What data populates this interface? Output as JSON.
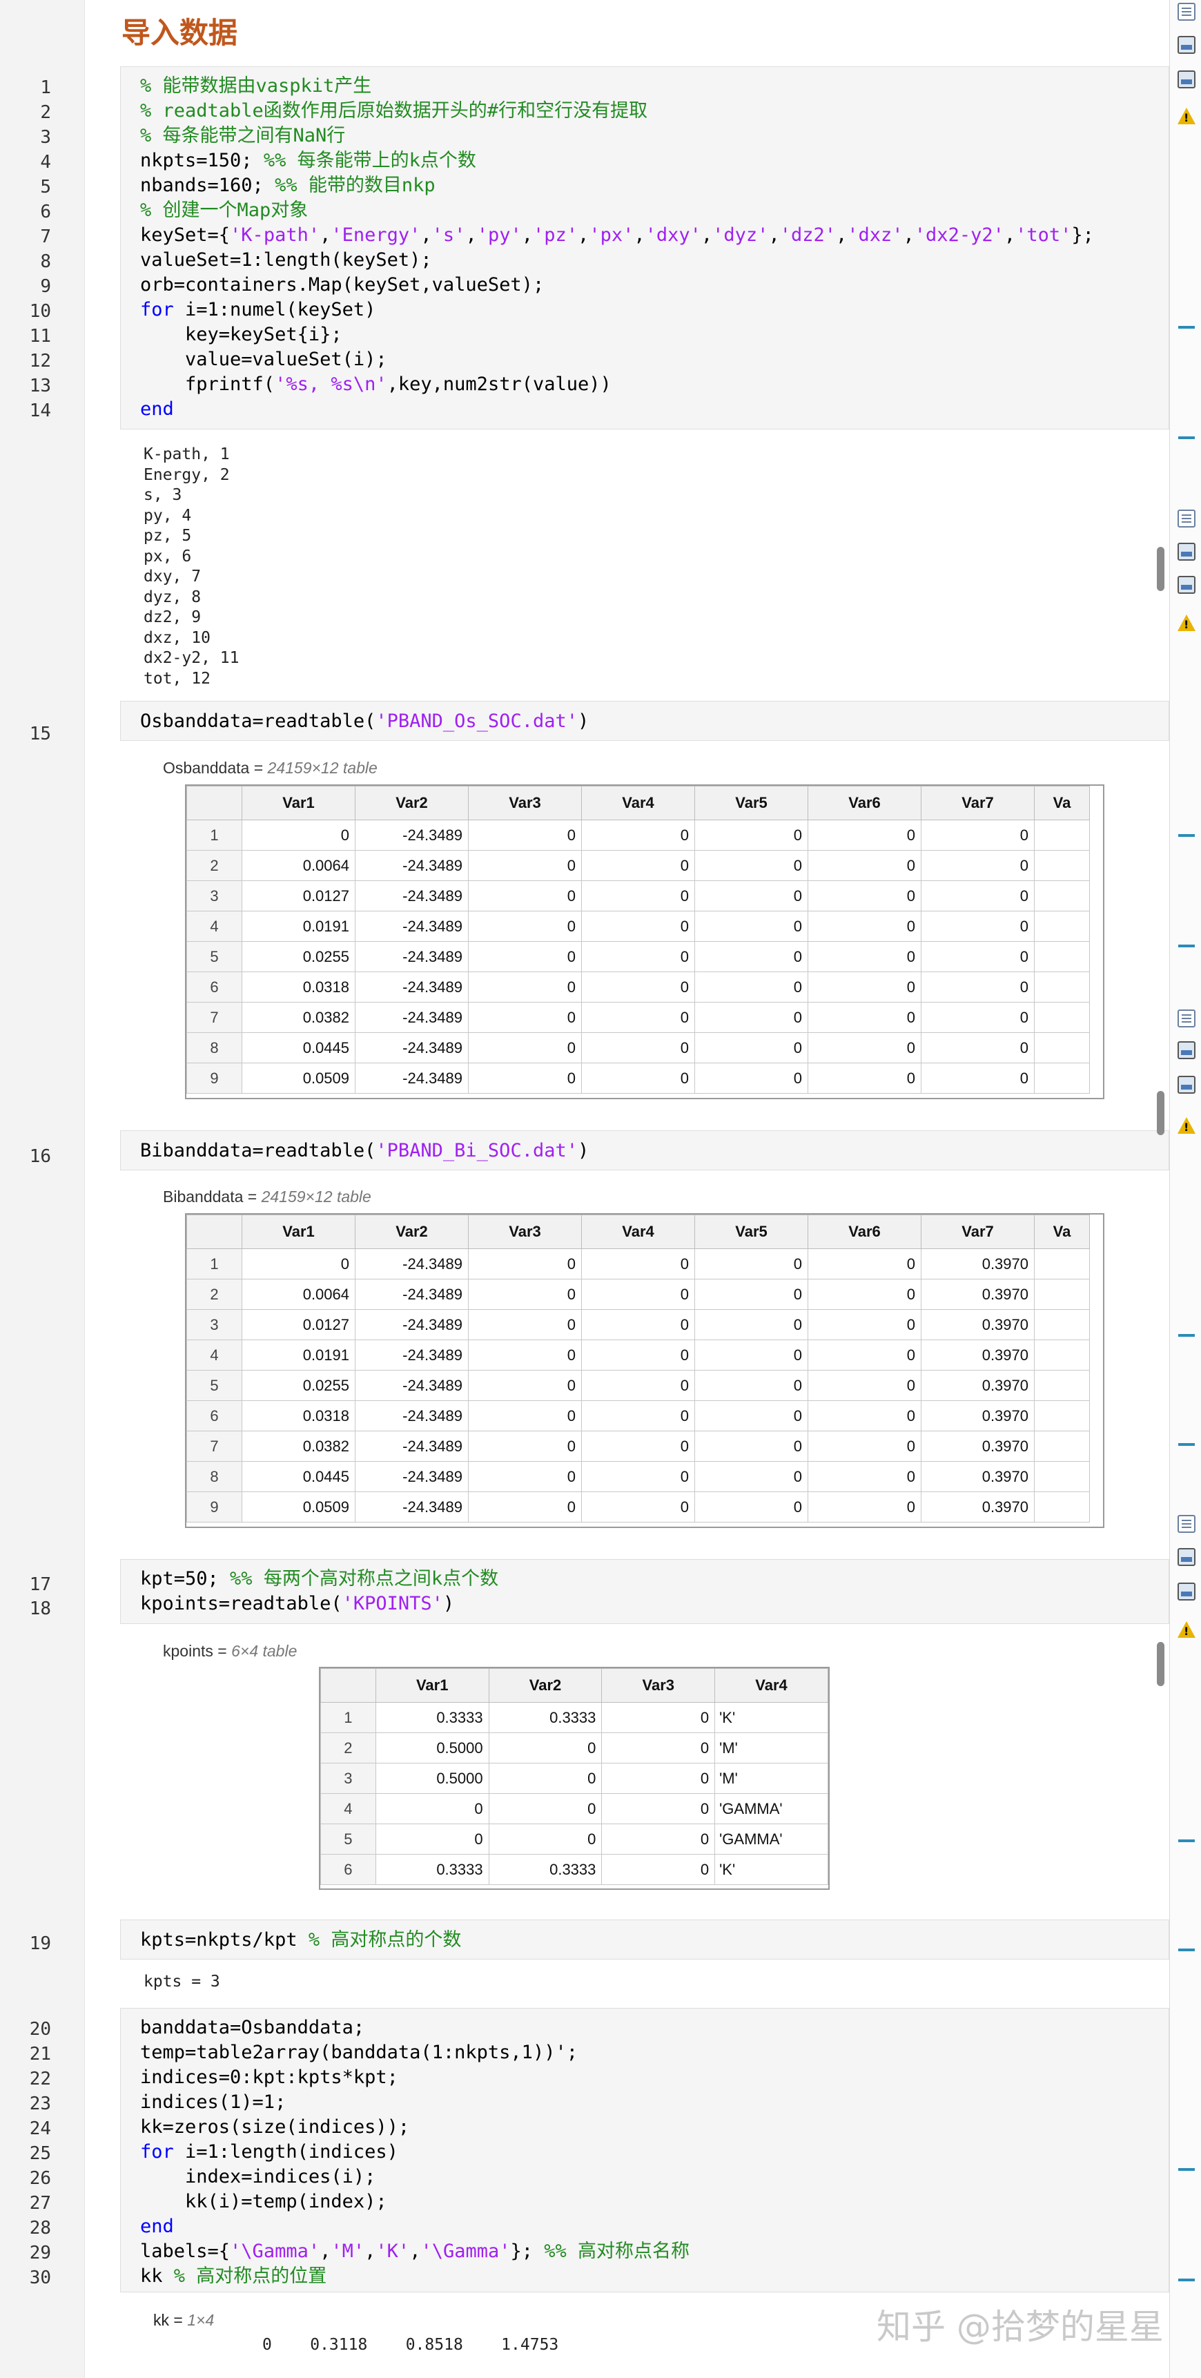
{
  "section_title": "导入数据",
  "code_block_1": {
    "line_numbers": [
      "1",
      "2",
      "3",
      "4",
      "5",
      "6",
      "7",
      "8",
      "9",
      "10",
      "11",
      "12",
      "13",
      "14"
    ]
  },
  "output_1": [
    "K-path, 1",
    "Energy, 2",
    "s, 3",
    "py, 4",
    "pz, 5",
    "px, 6",
    "dxy, 7",
    "dyz, 8",
    "dz2, 9",
    "dxz, 10",
    "dx2-y2, 11",
    "tot, 12"
  ],
  "line15": {
    "number": "15"
  },
  "osband": {
    "var_name": "Osbanddata =",
    "size_label": "24159×12 table",
    "columns": [
      "Var1",
      "Var2",
      "Var3",
      "Var4",
      "Var5",
      "Var6",
      "Var7",
      "Va"
    ],
    "rows": [
      [
        "1",
        "0",
        "-24.3489",
        "0",
        "0",
        "0",
        "0",
        "0"
      ],
      [
        "2",
        "0.0064",
        "-24.3489",
        "0",
        "0",
        "0",
        "0",
        "0"
      ],
      [
        "3",
        "0.0127",
        "-24.3489",
        "0",
        "0",
        "0",
        "0",
        "0"
      ],
      [
        "4",
        "0.0191",
        "-24.3489",
        "0",
        "0",
        "0",
        "0",
        "0"
      ],
      [
        "5",
        "0.0255",
        "-24.3489",
        "0",
        "0",
        "0",
        "0",
        "0"
      ],
      [
        "6",
        "0.0318",
        "-24.3489",
        "0",
        "0",
        "0",
        "0",
        "0"
      ],
      [
        "7",
        "0.0382",
        "-24.3489",
        "0",
        "0",
        "0",
        "0",
        "0"
      ],
      [
        "8",
        "0.0445",
        "-24.3489",
        "0",
        "0",
        "0",
        "0",
        "0"
      ],
      [
        "9",
        "0.0509",
        "-24.3489",
        "0",
        "0",
        "0",
        "0",
        "0"
      ]
    ]
  },
  "line16": {
    "number": "16"
  },
  "biband": {
    "var_name": "Bibanddata =",
    "size_label": "24159×12 table",
    "columns": [
      "Var1",
      "Var2",
      "Var3",
      "Var4",
      "Var5",
      "Var6",
      "Var7",
      "Va"
    ],
    "rows": [
      [
        "1",
        "0",
        "-24.3489",
        "0",
        "0",
        "0",
        "0",
        "0.3970"
      ],
      [
        "2",
        "0.0064",
        "-24.3489",
        "0",
        "0",
        "0",
        "0",
        "0.3970"
      ],
      [
        "3",
        "0.0127",
        "-24.3489",
        "0",
        "0",
        "0",
        "0",
        "0.3970"
      ],
      [
        "4",
        "0.0191",
        "-24.3489",
        "0",
        "0",
        "0",
        "0",
        "0.3970"
      ],
      [
        "5",
        "0.0255",
        "-24.3489",
        "0",
        "0",
        "0",
        "0",
        "0.3970"
      ],
      [
        "6",
        "0.0318",
        "-24.3489",
        "0",
        "0",
        "0",
        "0",
        "0.3970"
      ],
      [
        "7",
        "0.0382",
        "-24.3489",
        "0",
        "0",
        "0",
        "0",
        "0.3970"
      ],
      [
        "8",
        "0.0445",
        "-24.3489",
        "0",
        "0",
        "0",
        "0",
        "0.3970"
      ],
      [
        "9",
        "0.0509",
        "-24.3489",
        "0",
        "0",
        "0",
        "0",
        "0.3970"
      ]
    ]
  },
  "line17_18": {
    "numbers": [
      "17",
      "18"
    ]
  },
  "kpoints": {
    "var_name": "kpoints =",
    "size_label": "6×4 table",
    "columns": [
      "Var1",
      "Var2",
      "Var3",
      "Var4"
    ],
    "rows": [
      [
        "1",
        "0.3333",
        "0.3333",
        "0",
        "'K'"
      ],
      [
        "2",
        "0.5000",
        "0",
        "0",
        "'M'"
      ],
      [
        "3",
        "0.5000",
        "0",
        "0",
        "'M'"
      ],
      [
        "4",
        "0",
        "0",
        "0",
        "'GAMMA'"
      ],
      [
        "5",
        "0",
        "0",
        "0",
        "'GAMMA'"
      ],
      [
        "6",
        "0.3333",
        "0.3333",
        "0",
        "'K'"
      ]
    ]
  },
  "line19": {
    "number": "19"
  },
  "output_kpts": "kpts = 3",
  "code_block_2": {
    "line_numbers": [
      "20",
      "21",
      "22",
      "23",
      "24",
      "25",
      "26",
      "27",
      "28",
      "29",
      "30"
    ]
  },
  "output_kk": {
    "label": "kk =",
    "size_label": "1×4",
    "values": "0    0.3118    0.8518    1.4753"
  },
  "watermark": "知乎 @拾梦的星星",
  "colors": {
    "heading": "#c0571c",
    "comment": "#228b22",
    "keyword": "#0000ff",
    "string": "#a020f0",
    "sidebar_marker": "#2b8bb8"
  },
  "right_sidebar_icons": [
    "list-icon",
    "figure-icon",
    "image-icon",
    "warning-icon"
  ]
}
